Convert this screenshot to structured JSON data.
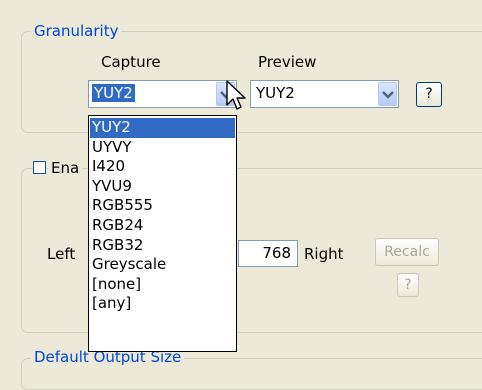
{
  "granularity": {
    "title": "Granularity",
    "capture_label": "Capture",
    "preview_label": "Preview",
    "capture_value": "YUY2",
    "preview_value": "YUY2",
    "help_label": "?"
  },
  "enable": {
    "label_partial": "Ena",
    "checked": false
  },
  "crop": {
    "left_label": "Left",
    "right_value": "768",
    "right_label": "Right",
    "recalc_label": "Recalc",
    "help_label": "?"
  },
  "default_output": {
    "title": "Default Output Size"
  },
  "dropdown": {
    "options": [
      "YUY2",
      "UYVY",
      "I420",
      "YVU9",
      "RGB555",
      "RGB24",
      "RGB32",
      "Greyscale",
      "[none]",
      "[any]"
    ],
    "selected_index": 0
  },
  "colors": {
    "background": "#ece9d8",
    "group_title": "#0046d5",
    "selection": "#316ac5"
  }
}
